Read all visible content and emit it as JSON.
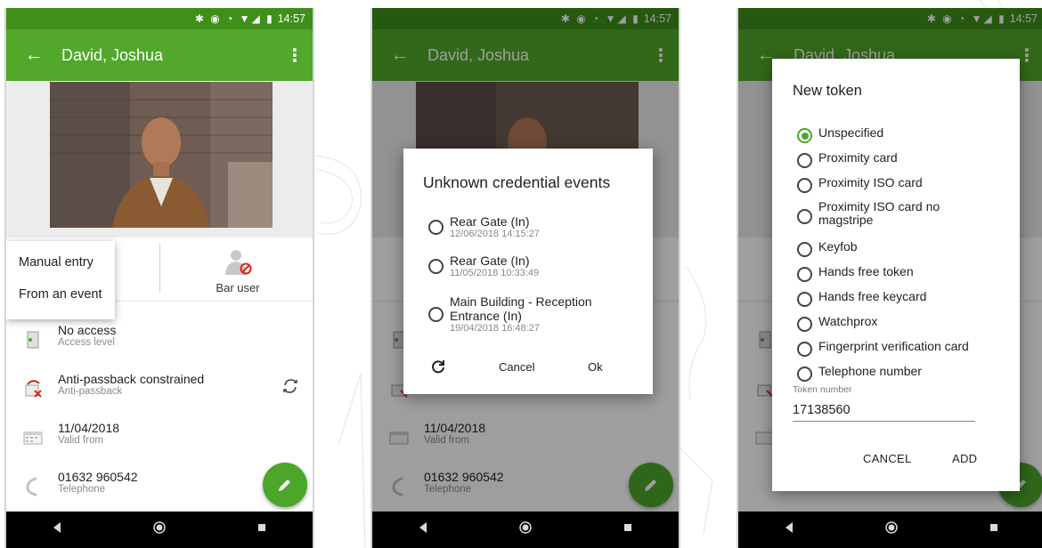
{
  "status_time": "14:57",
  "person_name": "David, Joshua",
  "popup_menu": {
    "manual_entry": "Manual entry",
    "from_event": "From an event"
  },
  "bar_user_label": "Bar user",
  "details": {
    "access": {
      "value": "No access",
      "label": "Access level"
    },
    "antipassback": {
      "value": "Anti-passback constrained",
      "label": "Anti-passback"
    },
    "valid_from": {
      "value": "11/04/2018",
      "label": "Valid from"
    },
    "telephone": {
      "value": "01632 960542",
      "label": "Telephone"
    }
  },
  "events_dialog": {
    "title": "Unknown credential events",
    "events": [
      {
        "name": "Rear Gate (In)",
        "date": "12/06/2018 14:15:27"
      },
      {
        "name": "Rear Gate (In)",
        "date": "11/05/2018 10:33:49"
      },
      {
        "name": "Main Building - Reception Entrance (In)",
        "date": "19/04/2018 16:48:27"
      }
    ],
    "cancel": "Cancel",
    "ok": "Ok"
  },
  "token_dialog": {
    "title": "New token",
    "options": [
      "Unspecified",
      "Proximity card",
      "Proximity ISO card",
      "Proximity ISO card no magstripe",
      "Keyfob",
      "Hands free token",
      "Hands free keycard",
      "Watchprox",
      "Fingerprint verification card",
      "Telephone number"
    ],
    "selected": "Unspecified",
    "token_number_label": "Token number",
    "token_number_value": "17138560",
    "cancel": "CANCEL",
    "add": "ADD"
  },
  "colors": {
    "brand_green": "#51a82a",
    "status_green": "#3f8f1b",
    "fab_green": "#4ba62a"
  }
}
